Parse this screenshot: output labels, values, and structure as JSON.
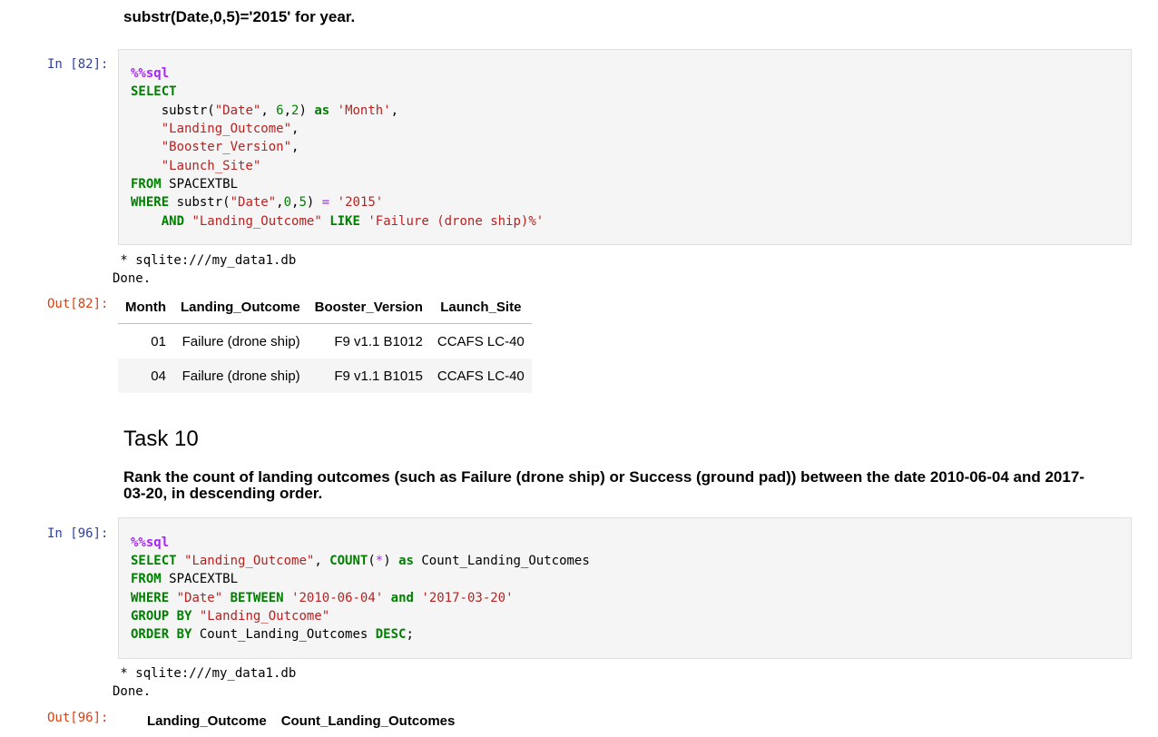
{
  "top_markdown": "substr(Date,0,5)='2015' for year.",
  "cell1": {
    "prompt_in": "In [82]:",
    "prompt_out": "Out[82]:",
    "code": {
      "l1": "%%sql",
      "l2": "SELECT",
      "l3_fn": "substr(",
      "l3_s1": "\"Date\"",
      "l3_args": ", ",
      "l3_n1": "6",
      "l3_c": ",",
      "l3_n2": "2",
      "l3_close": ") ",
      "l3_as": "as",
      "l3_s2": "'Month'",
      "l3_end": ",",
      "l4_s": "\"Landing_Outcome\"",
      "l4_end": ",",
      "l5_s": "\"Booster_Version\"",
      "l5_end": ",",
      "l6_s": "\"Launch_Site\"",
      "l7_kw": "FROM",
      "l7_t": " SPACEXTBL",
      "l8_kw": "WHERE",
      "l8_fn": " substr(",
      "l8_s1": "\"Date\"",
      "l8_c1": ",",
      "l8_n1": "0",
      "l8_c2": ",",
      "l8_n2": "5",
      "l8_close": ") ",
      "l8_eq": "=",
      "l8_sp": " ",
      "l8_s2": "'2015'",
      "l9_and": "AND",
      "l9_sp": " ",
      "l9_s1": "\"Landing_Outcome\"",
      "l9_sp2": " ",
      "l9_like": "LIKE",
      "l9_sp3": " ",
      "l9_s2": "'Failure (drone ship)%'"
    },
    "output_conn": " * sqlite:///my_data1.db",
    "output_done": "Done.",
    "table": {
      "headers": [
        "Month",
        "Landing_Outcome",
        "Booster_Version",
        "Launch_Site"
      ],
      "rows": [
        [
          "01",
          "Failure (drone ship)",
          "F9 v1.1 B1012",
          "CCAFS LC-40"
        ],
        [
          "04",
          "Failure (drone ship)",
          "F9 v1.1 B1015",
          "CCAFS LC-40"
        ]
      ]
    }
  },
  "task10": {
    "title": "Task 10",
    "description": "Rank the count of landing outcomes (such as Failure (drone ship) or Success (ground pad)) between the date 2010-06-04 and 2017-03-20, in descending order."
  },
  "cell2": {
    "prompt_in": "In [96]:",
    "prompt_out": "Out[96]:",
    "code": {
      "l1": "%%sql",
      "l2_kw": "SELECT",
      "l2_sp": " ",
      "l2_s": "\"Landing_Outcome\"",
      "l2_c": ", ",
      "l2_fn": "COUNT",
      "l2_p1": "(",
      "l2_star": "*",
      "l2_p2": ") ",
      "l2_as": "as",
      "l2_t": " Count_Landing_Outcomes",
      "l3_kw": "FROM",
      "l3_t": " SPACEXTBL",
      "l4_kw": "WHERE",
      "l4_sp": " ",
      "l4_s1": "\"Date\"",
      "l4_sp2": " ",
      "l4_between": "BETWEEN",
      "l4_sp3": " ",
      "l4_s2": "'2010-06-04'",
      "l4_sp4": " ",
      "l4_and": "and",
      "l4_sp5": " ",
      "l4_s3": "'2017-03-20'",
      "l5_kw": "GROUP BY",
      "l5_sp": " ",
      "l5_s": "\"Landing_Outcome\"",
      "l6_kw": "ORDER BY",
      "l6_t": " Count_Landing_Outcomes ",
      "l6_desc": "DESC",
      "l6_semi": ";"
    },
    "output_conn": " * sqlite:///my_data1.db",
    "output_done": "Done.",
    "table": {
      "headers": [
        "Landing_Outcome",
        "Count_Landing_Outcomes"
      ]
    }
  }
}
